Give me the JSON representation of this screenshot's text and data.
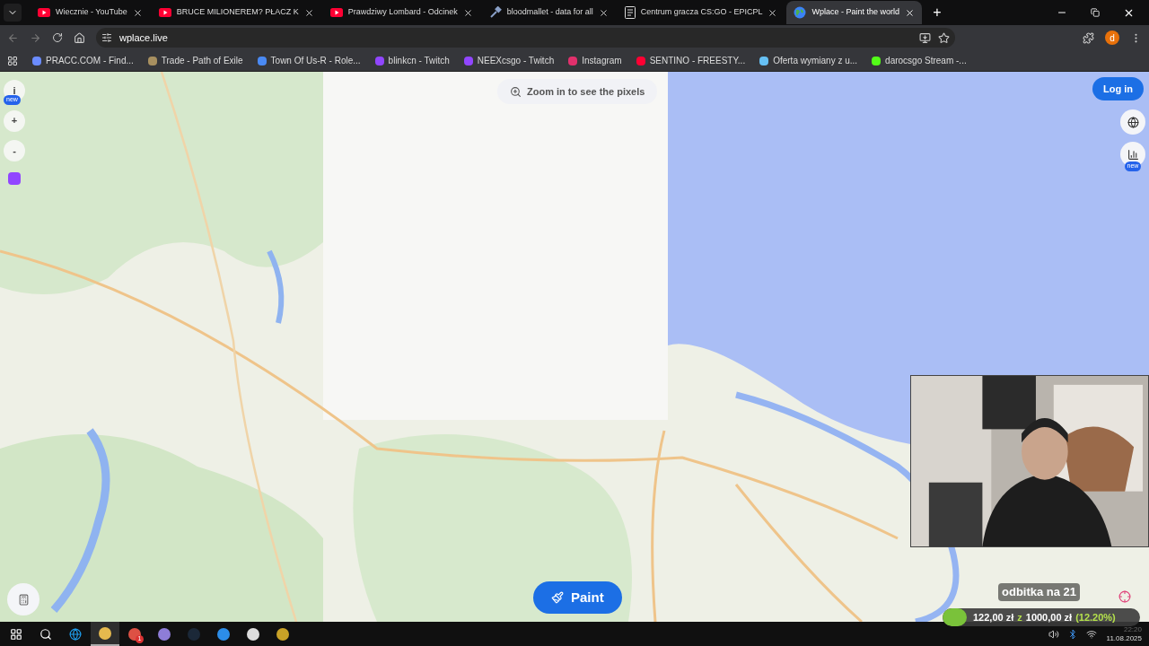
{
  "tabs": [
    {
      "title": "Wiecznie - YouTube",
      "kind": "video",
      "selected": false
    },
    {
      "title": "BRUCE MILIONEREM? PŁACZ K",
      "kind": "video",
      "selected": false
    },
    {
      "title": "Prawdziwy Lombard - Odcinek",
      "kind": "video",
      "selected": false
    },
    {
      "title": "bloodmallet - data for all",
      "kind": "tool",
      "selected": false
    },
    {
      "title": "Centrum gracza CS:GO - EPICPL",
      "kind": "brand",
      "selected": false
    },
    {
      "title": "Wplace - Paint the world",
      "kind": "globe",
      "selected": true
    }
  ],
  "new_tab": "+",
  "address": "wplace.live",
  "profile": "d",
  "bookmarks": [
    {
      "label": "PRACC.COM - Find...",
      "color": "#6b8cff"
    },
    {
      "label": "Trade - Path of Exile",
      "color": "#a89060"
    },
    {
      "label": "Town Of Us-R - Role...",
      "color": "#4a8af4"
    },
    {
      "label": "blinkcn - Twitch",
      "color": "#9146ff"
    },
    {
      "label": "NEEXcsgo - Twitch",
      "color": "#9146ff"
    },
    {
      "label": "Instagram",
      "color": "#e1306c"
    },
    {
      "label": "SENTINO - FREESTY...",
      "color": "#ff0033"
    },
    {
      "label": "Oferta wymiany z u...",
      "color": "#66c0f4"
    },
    {
      "label": "darocsgo Stream -...",
      "color": "#53fc18"
    }
  ],
  "page": {
    "zoom_hint": "Zoom in to see the pixels",
    "login": "Log in",
    "paint": "Paint",
    "left_controls": [
      {
        "label": "i",
        "badge": "new"
      },
      {
        "label": "+"
      },
      {
        "label": "-"
      }
    ],
    "stats_badge": "new"
  },
  "stream_overlay": {
    "caption": "odbitka na 21",
    "raised": "122,00 zł",
    "separator": "z",
    "goal": "1000,00 zł",
    "percent": "(12.20%)",
    "level": 0.122
  },
  "taskbar": {
    "apps": [
      {
        "selected": false
      },
      {
        "selected": false
      },
      {
        "selected": false
      },
      {
        "selected": true
      },
      {
        "selected": false,
        "badge": "1"
      },
      {
        "selected": false
      },
      {
        "selected": false
      },
      {
        "selected": false
      },
      {
        "selected": false
      },
      {
        "selected": false
      }
    ],
    "time": "22:20",
    "date": "11.08.2025"
  }
}
